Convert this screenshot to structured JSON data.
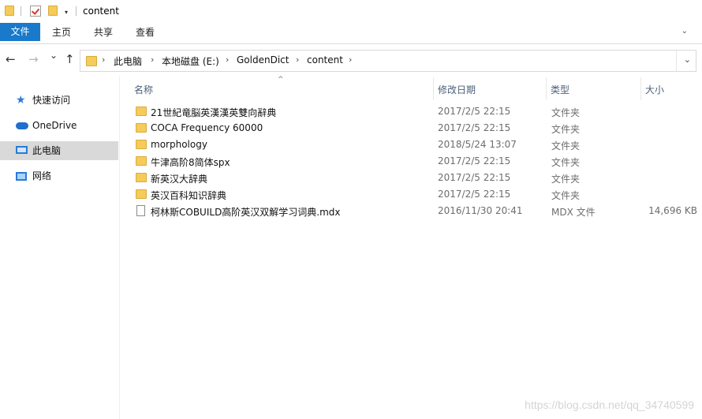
{
  "window": {
    "title": "content",
    "quick_access_dropdown": "▾"
  },
  "ribbon": {
    "tabs": [
      "文件",
      "主页",
      "共享",
      "查看"
    ],
    "expand_icon": "chevron-down-icon"
  },
  "nav": {
    "back": "←",
    "forward": "→",
    "recent": "⌄",
    "up": "↑",
    "breadcrumb": [
      "此电脑",
      "本地磁盘 (E:)",
      "GoldenDict",
      "content"
    ],
    "chevron": "›",
    "dropdown": "⌄"
  },
  "sidebar": {
    "items": [
      {
        "label": "快速访问",
        "icon": "star-icon"
      },
      {
        "label": "OneDrive",
        "icon": "cloud-icon"
      },
      {
        "label": "此电脑",
        "icon": "computer-icon",
        "selected": true
      },
      {
        "label": "网络",
        "icon": "network-icon"
      }
    ]
  },
  "file_list": {
    "sort_indicator": "^",
    "columns": [
      "名称",
      "修改日期",
      "类型",
      "大小"
    ],
    "rows": [
      {
        "name": "21世紀竜脳英漢漢英雙向辭典",
        "date": "2017/2/5 22:15",
        "type": "文件夹",
        "size": "",
        "kind": "folder"
      },
      {
        "name": "COCA Frequency 60000",
        "date": "2017/2/5 22:15",
        "type": "文件夹",
        "size": "",
        "kind": "folder"
      },
      {
        "name": "morphology",
        "date": "2018/5/24 13:07",
        "type": "文件夹",
        "size": "",
        "kind": "folder"
      },
      {
        "name": "牛津高阶8简体spx",
        "date": "2017/2/5 22:15",
        "type": "文件夹",
        "size": "",
        "kind": "folder"
      },
      {
        "name": "新英汉大辞典",
        "date": "2017/2/5 22:15",
        "type": "文件夹",
        "size": "",
        "kind": "folder"
      },
      {
        "name": "英汉百科知识辞典",
        "date": "2017/2/5 22:15",
        "type": "文件夹",
        "size": "",
        "kind": "folder"
      },
      {
        "name": "柯林斯COBUILD高阶英汉双解学习词典.mdx",
        "date": "2016/11/30 20:41",
        "type": "MDX 文件",
        "size": "14,696 KB",
        "kind": "file"
      }
    ]
  },
  "watermark": "https://blog.csdn.net/qq_34740599",
  "colors": {
    "accent": "#1979ca",
    "folder": "#f5cb5a",
    "selection": "#d9d9d9"
  }
}
